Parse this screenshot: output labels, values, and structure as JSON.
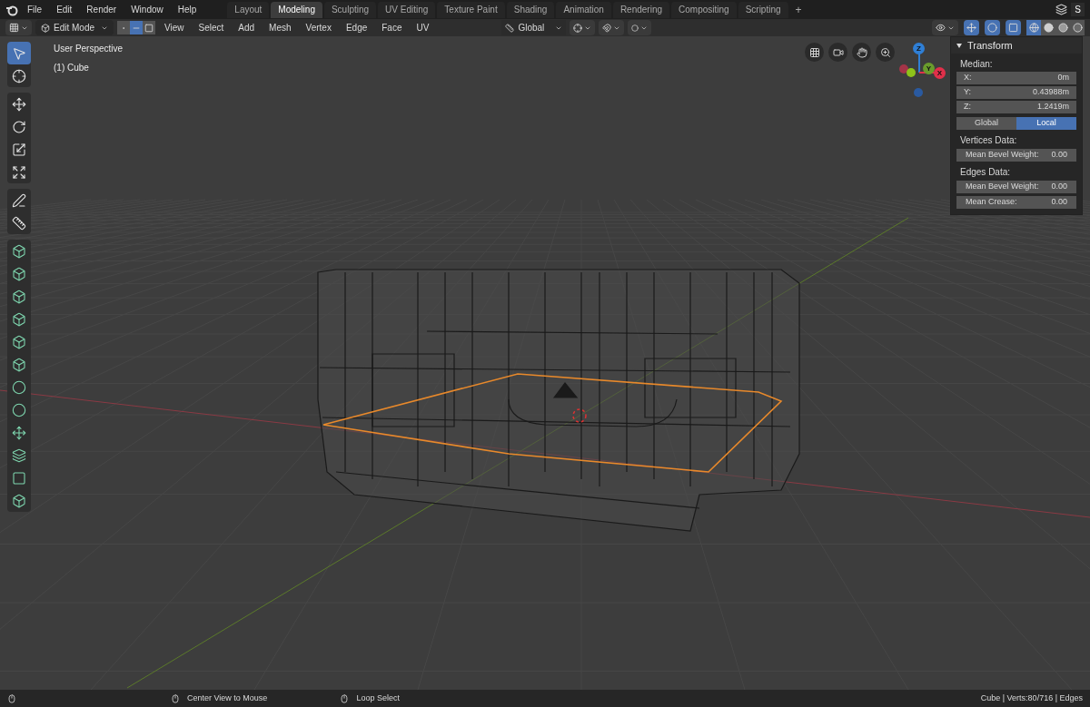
{
  "menus": [
    "File",
    "Edit",
    "Render",
    "Window",
    "Help"
  ],
  "workspaces": [
    {
      "label": "Layout",
      "selected": false
    },
    {
      "label": "Modeling",
      "selected": true
    },
    {
      "label": "Sculpting",
      "selected": false
    },
    {
      "label": "UV Editing",
      "selected": false
    },
    {
      "label": "Texture Paint",
      "selected": false
    },
    {
      "label": "Shading",
      "selected": false
    },
    {
      "label": "Animation",
      "selected": false
    },
    {
      "label": "Rendering",
      "selected": false
    },
    {
      "label": "Compositing",
      "selected": false
    },
    {
      "label": "Scripting",
      "selected": false
    }
  ],
  "add_workspace": "+",
  "scene_field": "S",
  "header": {
    "mode": "Edit Mode",
    "select_modes": [
      {
        "kind": "vertex",
        "selected": false
      },
      {
        "kind": "edge",
        "selected": true
      },
      {
        "kind": "face",
        "selected": false
      }
    ],
    "menus": [
      "View",
      "Select",
      "Add",
      "Mesh",
      "Vertex",
      "Edge",
      "Face",
      "UV"
    ],
    "orientation": "Global",
    "toggles": [
      {
        "kind": "gizmo",
        "on": true
      },
      {
        "kind": "overlay",
        "on": true
      },
      {
        "kind": "xray",
        "on": true
      }
    ],
    "shading": [
      {
        "kind": "wireframe",
        "selected": true
      },
      {
        "kind": "solid",
        "selected": false
      },
      {
        "kind": "material",
        "selected": false
      },
      {
        "kind": "rendered",
        "selected": false
      }
    ]
  },
  "viewport": {
    "view_name": "User Perspective",
    "object_name": "(1) Cube",
    "axes": [
      {
        "label": "Z",
        "color": "#2f7fd6"
      },
      {
        "label": "Y",
        "color": "#6a9c2c"
      },
      {
        "label": "X",
        "color": "#e0304a"
      }
    ]
  },
  "tool_groups": [
    [
      {
        "kind": "select",
        "selected": true
      },
      {
        "kind": "cursor",
        "selected": false
      }
    ],
    [
      {
        "kind": "move",
        "selected": false
      },
      {
        "kind": "rotate",
        "selected": false
      },
      {
        "kind": "scale",
        "selected": false
      },
      {
        "kind": "transform",
        "selected": false
      }
    ],
    [
      {
        "kind": "annotate",
        "selected": false
      },
      {
        "kind": "measure",
        "selected": false
      }
    ],
    [
      {
        "kind": "extrude",
        "selected": false
      },
      {
        "kind": "inset",
        "selected": false
      },
      {
        "kind": "bevel",
        "selected": false
      },
      {
        "kind": "loopcut",
        "selected": false
      },
      {
        "kind": "knife",
        "selected": false
      },
      {
        "kind": "polybuild",
        "selected": false
      },
      {
        "kind": "spin",
        "selected": false
      },
      {
        "kind": "smooth",
        "selected": false
      },
      {
        "kind": "slide",
        "selected": false
      },
      {
        "kind": "shrink",
        "selected": false
      },
      {
        "kind": "shear",
        "selected": false
      },
      {
        "kind": "rip",
        "selected": false
      }
    ]
  ],
  "panel": {
    "title": "Transform",
    "median_label": "Median:",
    "coords": [
      {
        "label": "X:",
        "value": "0m"
      },
      {
        "label": "Y:",
        "value": "0.43988m"
      },
      {
        "label": "Z:",
        "value": "1.2419m"
      }
    ],
    "space": [
      {
        "label": "Global",
        "selected": false
      },
      {
        "label": "Local",
        "selected": true
      }
    ],
    "sections": [
      {
        "title": "Vertices Data:",
        "fields": [
          {
            "label": "Mean Bevel Weight:",
            "value": "0.00"
          }
        ]
      },
      {
        "title": "Edges Data:",
        "fields": [
          {
            "label": "Mean Bevel Weight:",
            "value": "0.00"
          },
          {
            "label": "Mean Crease:",
            "value": "0.00"
          }
        ]
      }
    ]
  },
  "status_bar": {
    "hints": [
      "Center View to Mouse",
      "Loop Select"
    ],
    "stats": "Cube | Verts:80/716 | Edges"
  }
}
